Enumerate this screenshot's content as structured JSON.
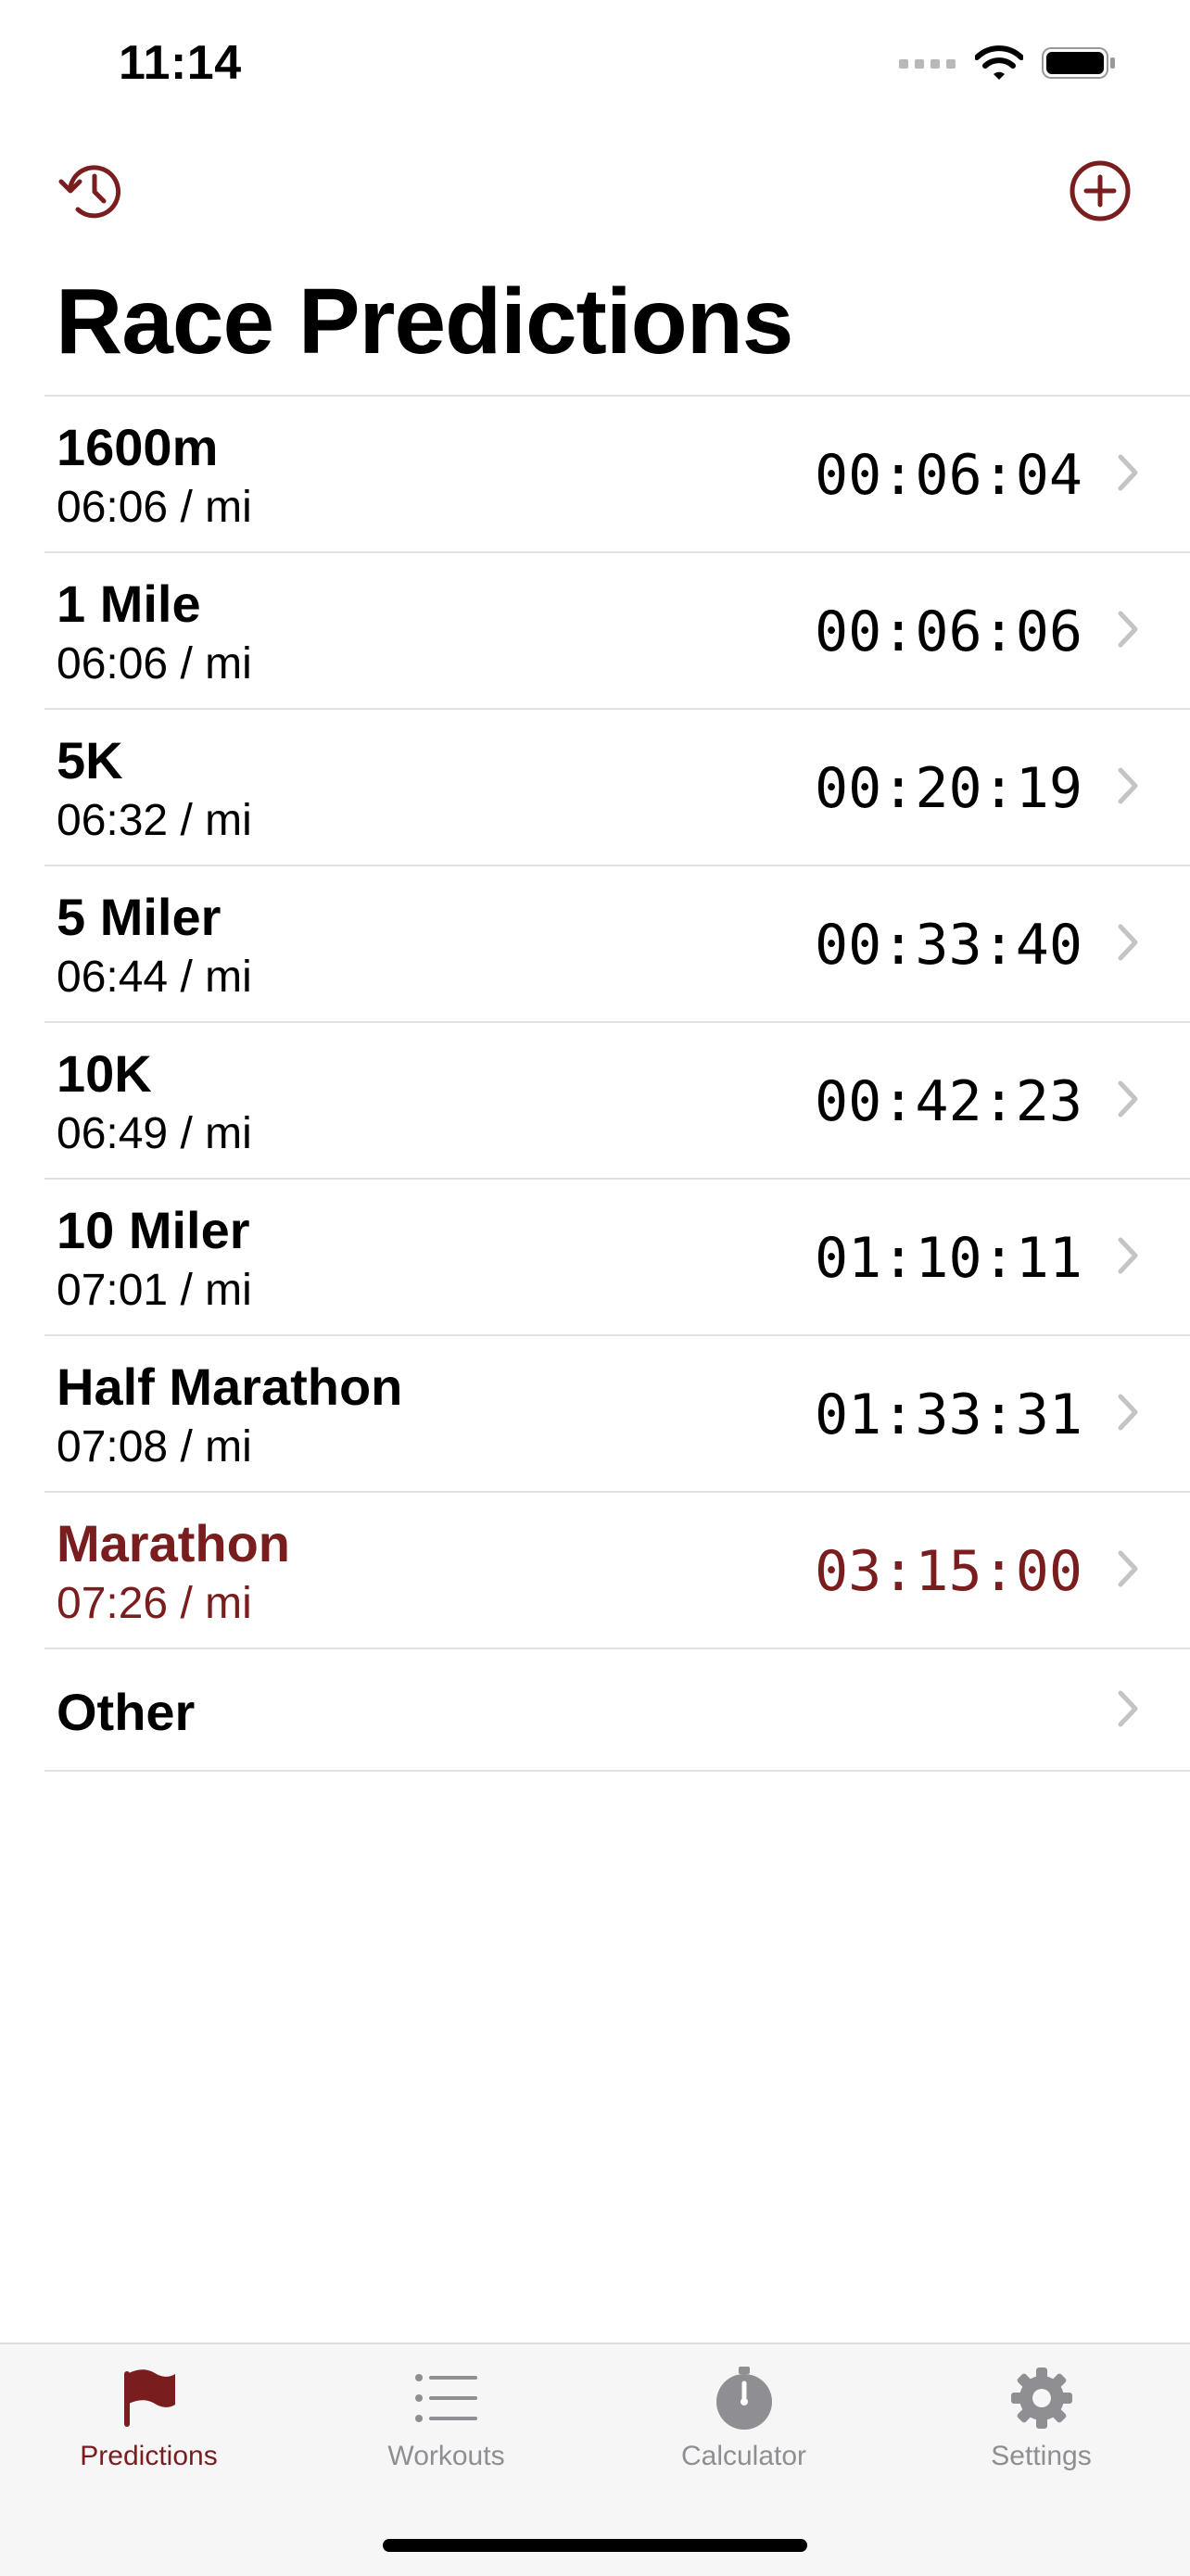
{
  "status_bar": {
    "time": "11:14"
  },
  "colors": {
    "accent": "#7a1d1f",
    "separator": "#e1e1e4",
    "chevron": "#c4c4c7",
    "inactive_tab": "#8e8e93",
    "tab_bar_bg": "#f6f6f6"
  },
  "nav": {
    "left_icon": "history-icon",
    "right_icon": "add-circle-icon",
    "title": "Race Predictions"
  },
  "predictions": [
    {
      "name": "1600m",
      "pace": "06:06 / mi",
      "time": "00:06:04"
    },
    {
      "name": "1 Mile",
      "pace": "06:06 / mi",
      "time": "00:06:06"
    },
    {
      "name": "5K",
      "pace": "06:32 / mi",
      "time": "00:20:19"
    },
    {
      "name": "5 Miler",
      "pace": "06:44 / mi",
      "time": "00:33:40"
    },
    {
      "name": "10K",
      "pace": "06:49 / mi",
      "time": "00:42:23"
    },
    {
      "name": "10 Miler",
      "pace": "07:01 / mi",
      "time": "01:10:11"
    },
    {
      "name": "Half Marathon",
      "pace": "07:08 / mi",
      "time": "01:33:31"
    },
    {
      "name": "Marathon",
      "pace": "07:26 / mi",
      "time": "03:15:00",
      "selected": true
    }
  ],
  "other": {
    "name": "Other"
  },
  "tabs": [
    {
      "label": "Predictions",
      "icon": "flag-icon",
      "active": true
    },
    {
      "label": "Workouts",
      "icon": "list-icon"
    },
    {
      "label": "Calculator",
      "icon": "stopwatch-icon"
    },
    {
      "label": "Settings",
      "icon": "gear-icon"
    }
  ]
}
